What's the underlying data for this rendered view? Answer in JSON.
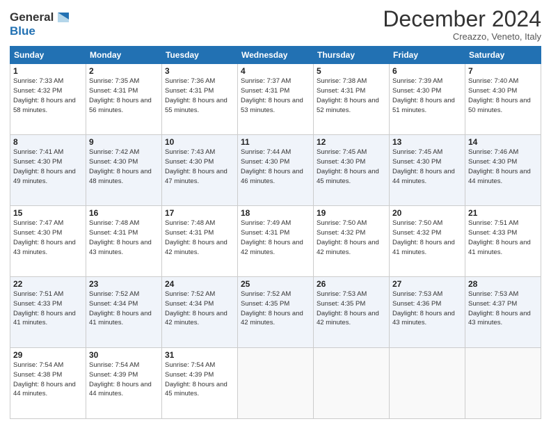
{
  "logo": {
    "line1": "General",
    "line2": "Blue"
  },
  "title": "December 2024",
  "subtitle": "Creazzo, Veneto, Italy",
  "weekdays": [
    "Sunday",
    "Monday",
    "Tuesday",
    "Wednesday",
    "Thursday",
    "Friday",
    "Saturday"
  ],
  "weeks": [
    [
      {
        "day": "1",
        "sunrise": "7:33 AM",
        "sunset": "4:32 PM",
        "daylight": "8 hours and 58 minutes."
      },
      {
        "day": "2",
        "sunrise": "7:35 AM",
        "sunset": "4:31 PM",
        "daylight": "8 hours and 56 minutes."
      },
      {
        "day": "3",
        "sunrise": "7:36 AM",
        "sunset": "4:31 PM",
        "daylight": "8 hours and 55 minutes."
      },
      {
        "day": "4",
        "sunrise": "7:37 AM",
        "sunset": "4:31 PM",
        "daylight": "8 hours and 53 minutes."
      },
      {
        "day": "5",
        "sunrise": "7:38 AM",
        "sunset": "4:31 PM",
        "daylight": "8 hours and 52 minutes."
      },
      {
        "day": "6",
        "sunrise": "7:39 AM",
        "sunset": "4:30 PM",
        "daylight": "8 hours and 51 minutes."
      },
      {
        "day": "7",
        "sunrise": "7:40 AM",
        "sunset": "4:30 PM",
        "daylight": "8 hours and 50 minutes."
      }
    ],
    [
      {
        "day": "8",
        "sunrise": "7:41 AM",
        "sunset": "4:30 PM",
        "daylight": "8 hours and 49 minutes."
      },
      {
        "day": "9",
        "sunrise": "7:42 AM",
        "sunset": "4:30 PM",
        "daylight": "8 hours and 48 minutes."
      },
      {
        "day": "10",
        "sunrise": "7:43 AM",
        "sunset": "4:30 PM",
        "daylight": "8 hours and 47 minutes."
      },
      {
        "day": "11",
        "sunrise": "7:44 AM",
        "sunset": "4:30 PM",
        "daylight": "8 hours and 46 minutes."
      },
      {
        "day": "12",
        "sunrise": "7:45 AM",
        "sunset": "4:30 PM",
        "daylight": "8 hours and 45 minutes."
      },
      {
        "day": "13",
        "sunrise": "7:45 AM",
        "sunset": "4:30 PM",
        "daylight": "8 hours and 44 minutes."
      },
      {
        "day": "14",
        "sunrise": "7:46 AM",
        "sunset": "4:30 PM",
        "daylight": "8 hours and 44 minutes."
      }
    ],
    [
      {
        "day": "15",
        "sunrise": "7:47 AM",
        "sunset": "4:30 PM",
        "daylight": "8 hours and 43 minutes."
      },
      {
        "day": "16",
        "sunrise": "7:48 AM",
        "sunset": "4:31 PM",
        "daylight": "8 hours and 43 minutes."
      },
      {
        "day": "17",
        "sunrise": "7:48 AM",
        "sunset": "4:31 PM",
        "daylight": "8 hours and 42 minutes."
      },
      {
        "day": "18",
        "sunrise": "7:49 AM",
        "sunset": "4:31 PM",
        "daylight": "8 hours and 42 minutes."
      },
      {
        "day": "19",
        "sunrise": "7:50 AM",
        "sunset": "4:32 PM",
        "daylight": "8 hours and 42 minutes."
      },
      {
        "day": "20",
        "sunrise": "7:50 AM",
        "sunset": "4:32 PM",
        "daylight": "8 hours and 41 minutes."
      },
      {
        "day": "21",
        "sunrise": "7:51 AM",
        "sunset": "4:33 PM",
        "daylight": "8 hours and 41 minutes."
      }
    ],
    [
      {
        "day": "22",
        "sunrise": "7:51 AM",
        "sunset": "4:33 PM",
        "daylight": "8 hours and 41 minutes."
      },
      {
        "day": "23",
        "sunrise": "7:52 AM",
        "sunset": "4:34 PM",
        "daylight": "8 hours and 41 minutes."
      },
      {
        "day": "24",
        "sunrise": "7:52 AM",
        "sunset": "4:34 PM",
        "daylight": "8 hours and 42 minutes."
      },
      {
        "day": "25",
        "sunrise": "7:52 AM",
        "sunset": "4:35 PM",
        "daylight": "8 hours and 42 minutes."
      },
      {
        "day": "26",
        "sunrise": "7:53 AM",
        "sunset": "4:35 PM",
        "daylight": "8 hours and 42 minutes."
      },
      {
        "day": "27",
        "sunrise": "7:53 AM",
        "sunset": "4:36 PM",
        "daylight": "8 hours and 43 minutes."
      },
      {
        "day": "28",
        "sunrise": "7:53 AM",
        "sunset": "4:37 PM",
        "daylight": "8 hours and 43 minutes."
      }
    ],
    [
      {
        "day": "29",
        "sunrise": "7:54 AM",
        "sunset": "4:38 PM",
        "daylight": "8 hours and 44 minutes."
      },
      {
        "day": "30",
        "sunrise": "7:54 AM",
        "sunset": "4:39 PM",
        "daylight": "8 hours and 44 minutes."
      },
      {
        "day": "31",
        "sunrise": "7:54 AM",
        "sunset": "4:39 PM",
        "daylight": "8 hours and 45 minutes."
      },
      null,
      null,
      null,
      null
    ]
  ]
}
